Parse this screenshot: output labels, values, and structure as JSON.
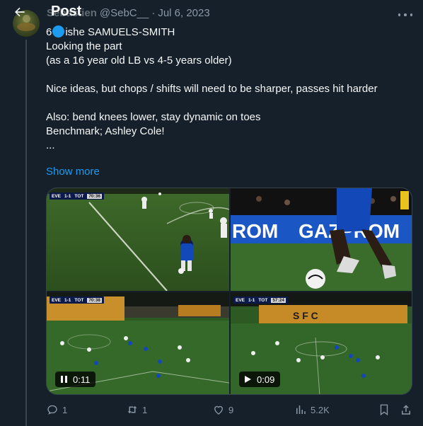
{
  "header": {
    "title": "Post"
  },
  "tweet": {
    "author_name": "Sébastien",
    "author_handle": "@SebC__",
    "dot": "·",
    "date": "Jul 6, 2023",
    "text_prefix": "6",
    "text_after_dot": "ishe SAMUELS-SMITH",
    "text_body": "\nLooking the part\n(as a 16 year old LB vs 4-5 years older)\n\nNice ideas, but chops / shifts will need to be sharper, passes hit harder\n\nAlso: bend knees lower, stay dynamic on toes\nBenchmark; Ashley Cole!\n...",
    "show_more": "Show more"
  },
  "media": [
    {
      "kind": "video-frame",
      "scorebug": {
        "home": "EVE",
        "score": "1-1",
        "away": "TOT",
        "clock": "70:36"
      }
    },
    {
      "kind": "video-frame",
      "banner": "ROM  GAZPROM"
    },
    {
      "kind": "video",
      "duration": "0:11",
      "state": "paused",
      "scorebug": {
        "home": "EVE",
        "score": "1-1",
        "away": "TOT",
        "clock": "70:38"
      }
    },
    {
      "kind": "video",
      "duration": "0:09",
      "state": "play",
      "stand_letters": "S F C",
      "scorebug": {
        "home": "EVE",
        "score": "1-1",
        "away": "TOT",
        "clock": "57:24"
      }
    }
  ],
  "actions": {
    "replies": "1",
    "reposts": "1",
    "likes": "9",
    "views": "5.2K"
  },
  "colors": {
    "accent": "#1d9bf0",
    "background": "#15202b",
    "muted": "#8b98a5",
    "border": "#38444d"
  }
}
